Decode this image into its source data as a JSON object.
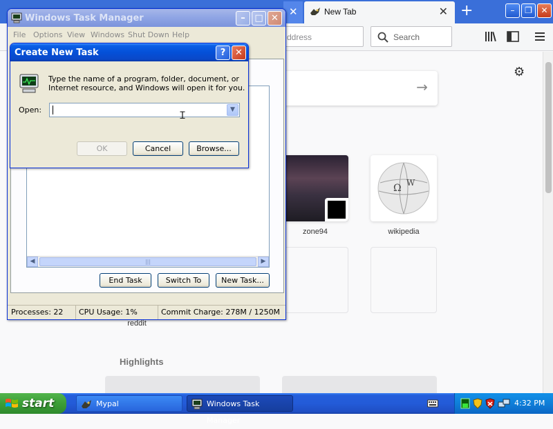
{
  "browser": {
    "tab_label": "New Tab",
    "address_placeholder": "ddress",
    "search_placeholder": "Search",
    "tiles": [
      {
        "label": "zone94"
      },
      {
        "label": "wikipedia"
      },
      {
        "label": "reddit"
      }
    ],
    "highlights_heading": "Highlights"
  },
  "task_manager": {
    "title": "Windows Task Manager",
    "menu": [
      "File",
      "Options",
      "View",
      "Windows",
      "Shut Down",
      "Help"
    ],
    "buttons": {
      "end_task": "End Task",
      "switch_to": "Switch To",
      "new_task": "New Task..."
    },
    "status": {
      "processes": "Processes: 22",
      "cpu": "CPU Usage: 1%",
      "commit": "Commit Charge: 278M / 1250M"
    }
  },
  "create_task": {
    "title": "Create New Task",
    "description_line1": "Type the name of a program, folder, document, or",
    "description_line2": "Internet resource, and Windows will open it for you.",
    "open_label": "Open:",
    "open_value": "",
    "ok": "OK",
    "cancel": "Cancel",
    "browse": "Browse..."
  },
  "taskbar": {
    "start": "start",
    "tasks": [
      {
        "label": "Mypal",
        "active": false
      },
      {
        "label": "Windows Task Manager",
        "active": true
      }
    ],
    "clock": "4:32 PM"
  }
}
